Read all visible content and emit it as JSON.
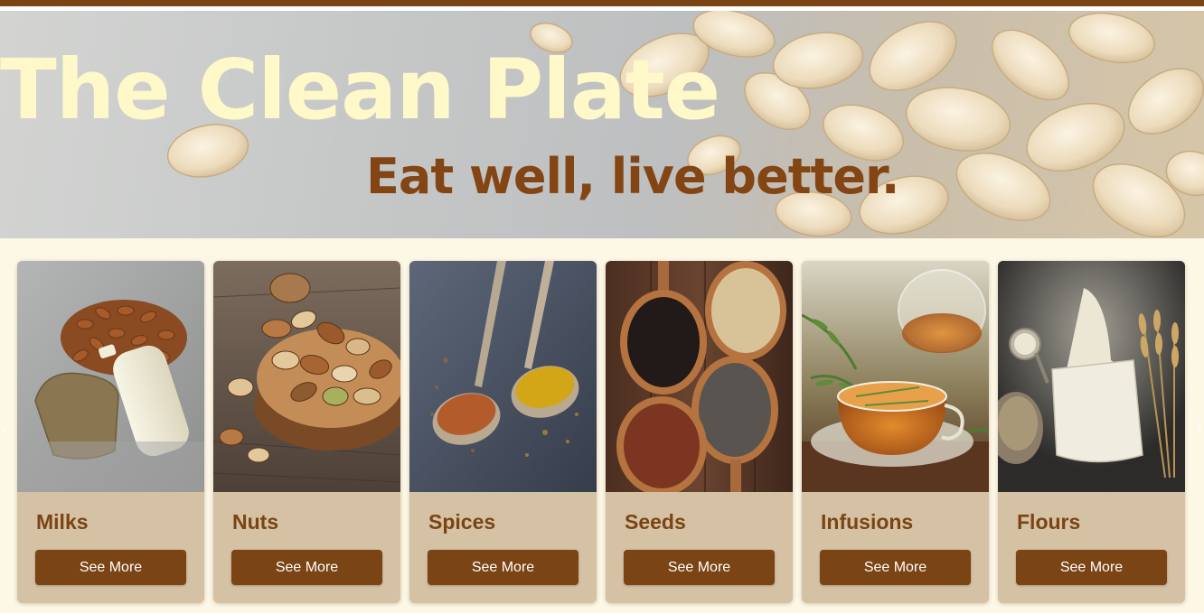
{
  "hero": {
    "title": "The Clean Plate",
    "tagline": "Eat well, live better."
  },
  "categories": [
    {
      "title": "Milks",
      "button": "See More"
    },
    {
      "title": "Nuts",
      "button": "See More"
    },
    {
      "title": "Spices",
      "button": "See More"
    },
    {
      "title": "Seeds",
      "button": "See More"
    },
    {
      "title": "Infusions",
      "button": "See More"
    },
    {
      "title": "Flours",
      "button": "See More"
    }
  ],
  "carousel": {
    "prev_icon": "chevron-left-icon",
    "next_icon": "chevron-right-icon"
  },
  "colors": {
    "brand_brown": "#7b4415",
    "title_cream": "#fff8c8",
    "card_tan": "#d5c1a3",
    "page_bg": "#fdf7e6"
  }
}
